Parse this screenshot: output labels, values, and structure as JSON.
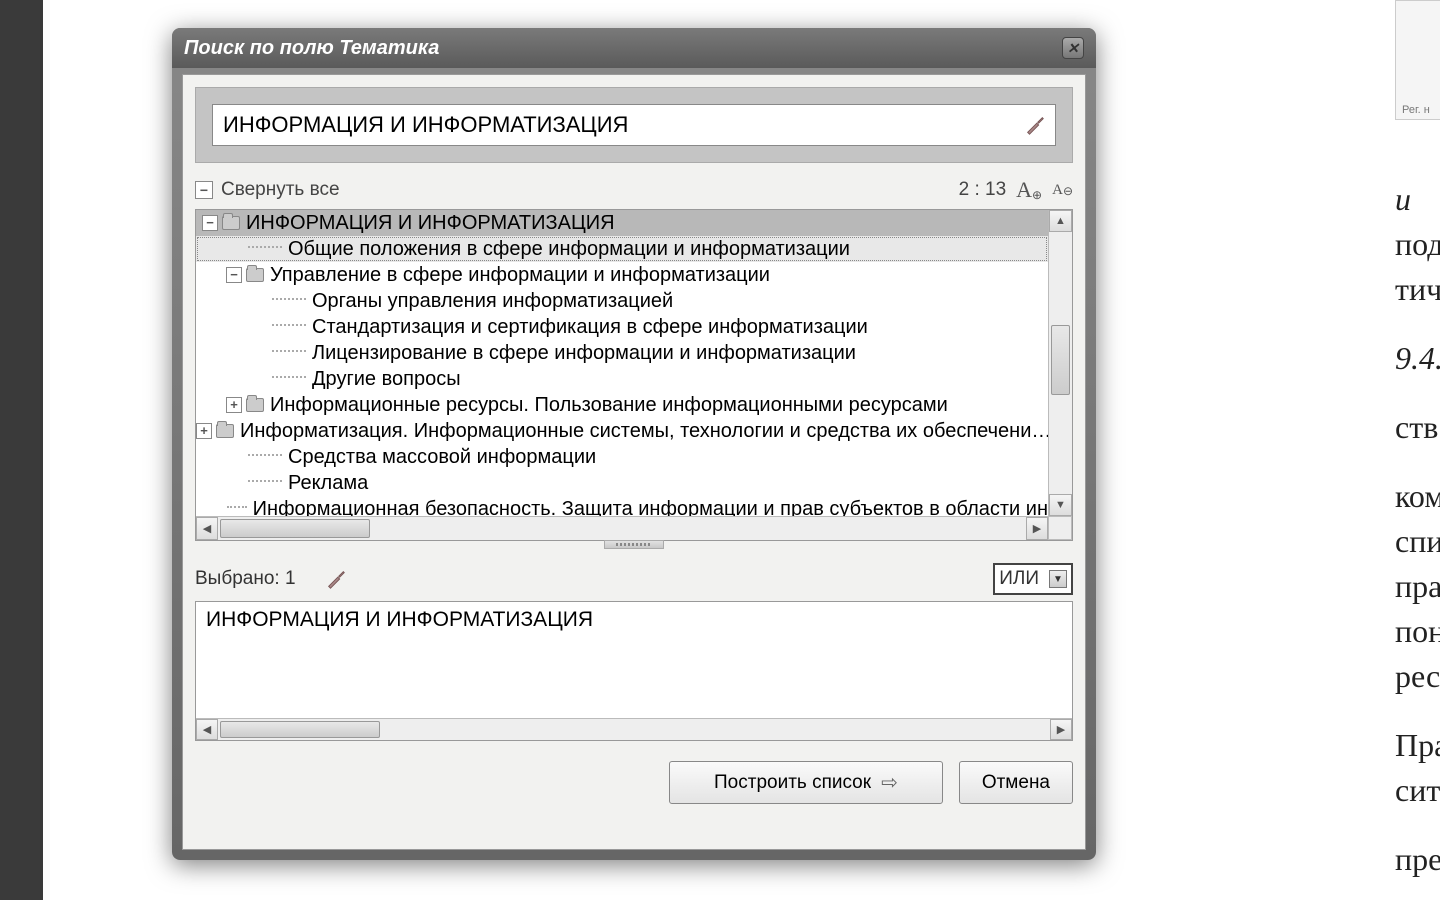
{
  "dialog": {
    "title": "Поиск по полю Тематика",
    "search_value": "ИНФОРМАЦИЯ И ИНФОРМАТИЗАЦИЯ",
    "collapse_all": "Свернуть все",
    "counter": "2 : 13"
  },
  "tree": {
    "root": "ИНФОРМАЦИЯ И ИНФОРМАТИЗАЦИЯ",
    "n1": "Общие положения в сфере информации и информатизации",
    "n2": "Управление в сфере информации и информатизации",
    "n2a": "Органы управления информатизацией",
    "n2b": "Стандартизация и сертификация в сфере информатизации",
    "n2c": "Лицензирование в сфере информации и информатизации",
    "n2d": "Другие вопросы",
    "n3": "Информационные ресурсы. Пользование информационными ресурсами",
    "n4": "Информатизация. Информационные системы, технологии и средства их обеспечени…",
    "n5": "Средства массовой информации",
    "n6": "Реклама",
    "n7": "Информационная безопасность. Защита информации и прав субъектов в области ин"
  },
  "selection": {
    "label_prefix": "Выбрано: 1",
    "logic": "ИЛИ",
    "selected_item": "ИНФОРМАЦИЯ И ИНФОРМАТИЗАЦИЯ"
  },
  "buttons": {
    "build": "Построить список",
    "cancel": "Отмена"
  },
  "right_panel": {
    "stub": "Рег. н",
    "t1": "и",
    "t2": "под",
    "t3": "тич",
    "t4": "9.4.",
    "t5": "ств",
    "t6": "ком",
    "t7": "спи",
    "t8": "пра",
    "t9": "пон",
    "t10": "рес",
    "t11": "Пра",
    "t12": "сит",
    "t13": "пре"
  }
}
